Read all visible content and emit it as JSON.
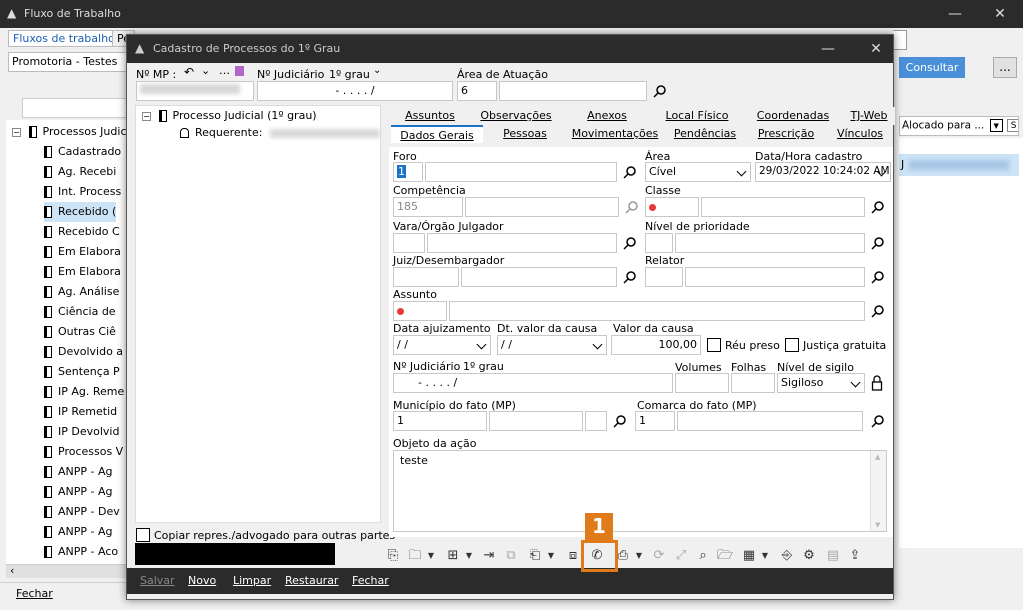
{
  "bg_window": {
    "title": "Fluxo de Trabalho",
    "tabs": [
      "Fluxos de trabalho",
      "Pe"
    ],
    "promotoria": "Promotoria - Testes",
    "consultar": "Consultar",
    "dots": "...",
    "alocado_header": "Alocado para ...",
    "alocado_col2": "S",
    "sel_row_text": "J",
    "tree_root": "Processos Judici",
    "tree_items": [
      "Cadastrado",
      "Ag. Recebi",
      "Int. Process",
      "Recebido (",
      "Recebido C",
      "Em Elabora",
      "Em Elabora",
      "Ag. Análise",
      "Ciência de",
      "Outras Ciê",
      "Devolvido a",
      "Sentença P",
      "IP Ag. Reme",
      "IP Remetid",
      "IP Devolvid",
      "Processos V",
      "ANPP - Ag",
      "ANPP - Ag",
      "ANPP - Dev",
      "ANPP - Ag",
      "ANPP - Aco"
    ],
    "fechar": "Fechar"
  },
  "modal": {
    "title": "Cadastro de Processos do 1º Grau",
    "mp_label": "Nº MP :",
    "judicial_label": "Nº Judiciário",
    "grau_label": "1º grau",
    "judicial_value": "- .   . . .   /",
    "area_label": "Área de Atuação",
    "area_value": "6",
    "tree_root": "Processo Judicial (1º grau)",
    "tree_child": "Requerente:",
    "copy_label": "Copiar repres./advogado para outras partes",
    "tabs_row1": [
      "Assuntos",
      "Observações",
      "Anexos",
      "Local Físico",
      "Coordenadas",
      "TJ-Web"
    ],
    "tabs_row2": [
      "Dados Gerais",
      "Pessoas",
      "Movimentações",
      "Pendências",
      "Prescrição",
      "Vínculos"
    ],
    "form": {
      "foro_label": "Foro",
      "foro_value": "1",
      "area_label": "Área",
      "area_value": "Cível",
      "datahora_label": "Data/Hora cadastro",
      "datahora_value": "29/03/2022 10:24:02 AM",
      "competencia_label": "Competência",
      "competencia_value": "185",
      "classe_label": "Classe",
      "vara_label": "Vara/Órgão Julgador",
      "nivel_prioridade_label": "Nível de prioridade",
      "juiz_label": "Juiz/Desembargador",
      "relator_label": "Relator",
      "assunto_label": "Assunto",
      "data_ajuizamento_label": "Data ajuizamento",
      "data_ajuizamento_value": "/ /",
      "dt_valor_label": "Dt. valor da causa",
      "dt_valor_value": "/ /",
      "valor_label": "Valor da causa",
      "valor_value": "100,00",
      "reu_preso_label": "Réu preso",
      "justica_gratuita_label": "Justiça gratuita",
      "num_judicial_label": "Nº Judiciário",
      "num_grau_label": "1º grau",
      "num_judicial_value": "- .   . . .   /",
      "volumes_label": "Volumes",
      "folhas_label": "Folhas",
      "nivel_sigilo_label": "Nível de sigilo",
      "nivel_sigilo_value": "Sigiloso",
      "municipio_label": "Município do fato (MP)",
      "municipio_value": "1",
      "comarca_label": "Comarca do fato (MP)",
      "comarca_value": "1",
      "objeto_label": "Objeto da ação",
      "objeto_value": "teste"
    },
    "bottom_buttons": [
      "Salvar",
      "Novo",
      "Limpar",
      "Restaurar",
      "Fechar"
    ],
    "badge": "1"
  },
  "colors": {
    "accent": "#1a73c8",
    "highlight": "#e07b1a",
    "titlebar": "#2b2b2b",
    "required": "#e53935"
  }
}
